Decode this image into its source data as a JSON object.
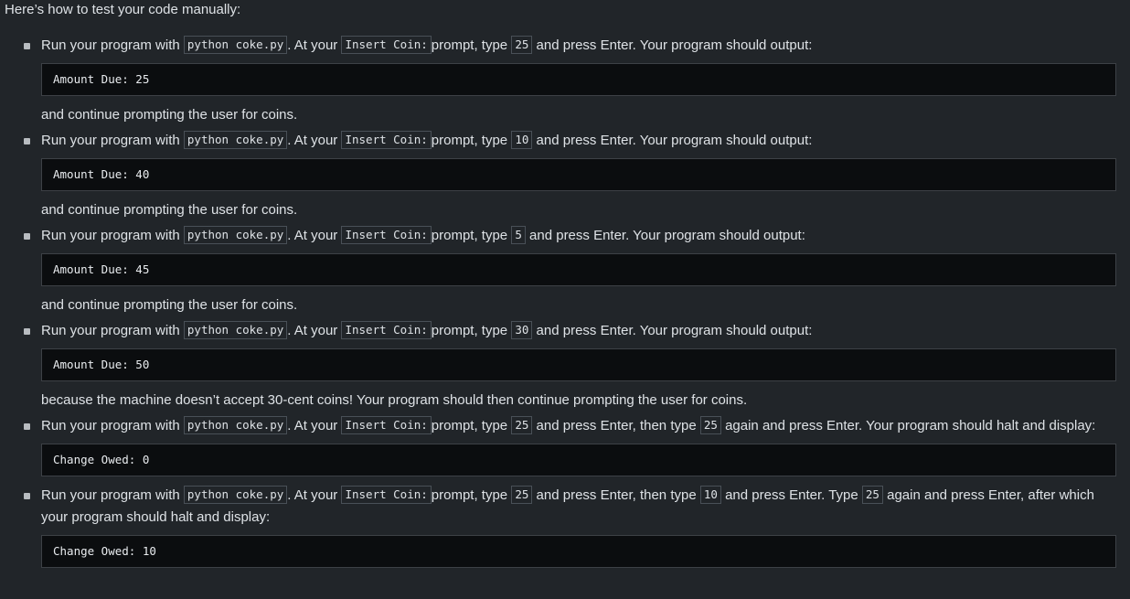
{
  "intro": "Here’s how to test your code manually:",
  "steps": [
    {
      "parts": [
        "Run your program with ",
        "python coke.py",
        ". At your ",
        "Insert Coin: ",
        "prompt, type ",
        "25",
        " and press Enter. Your program should output:"
      ],
      "output": "Amount Due: 25",
      "follow": "and continue prompting the user for coins."
    },
    {
      "parts": [
        "Run your program with ",
        "python coke.py",
        ". At your ",
        "Insert Coin: ",
        "prompt, type ",
        "10",
        " and press Enter. Your program should output:"
      ],
      "output": "Amount Due: 40",
      "follow": "and continue prompting the user for coins."
    },
    {
      "parts": [
        "Run your program with ",
        "python coke.py",
        ". At your ",
        "Insert Coin: ",
        "prompt, type ",
        "5",
        " and press Enter. Your program should output:"
      ],
      "output": "Amount Due: 45",
      "follow": "and continue prompting the user for coins."
    },
    {
      "parts": [
        "Run your program with ",
        "python coke.py",
        ". At your ",
        "Insert Coin: ",
        "prompt, type ",
        "30",
        " and press Enter. Your program should output:"
      ],
      "output": "Amount Due: 50",
      "follow": "because the machine doesn’t accept 30-cent coins! Your program should then continue prompting the user for coins."
    },
    {
      "parts": [
        "Run your program with ",
        "python coke.py",
        ". At your ",
        "Insert Coin: ",
        "prompt, type ",
        "25",
        " and press Enter, then type ",
        "25",
        " again and press Enter. Your program should halt and display:"
      ],
      "output": "Change Owed: 0",
      "follow": ""
    },
    {
      "parts": [
        "Run your program with ",
        "python coke.py",
        ". At your ",
        "Insert Coin: ",
        "prompt, type ",
        "25",
        " and press Enter, then type ",
        "10",
        " and press Enter. Type ",
        "25",
        " again and press Enter, after which your program should halt and display:"
      ],
      "output": "Change Owed: 10",
      "follow": ""
    }
  ]
}
